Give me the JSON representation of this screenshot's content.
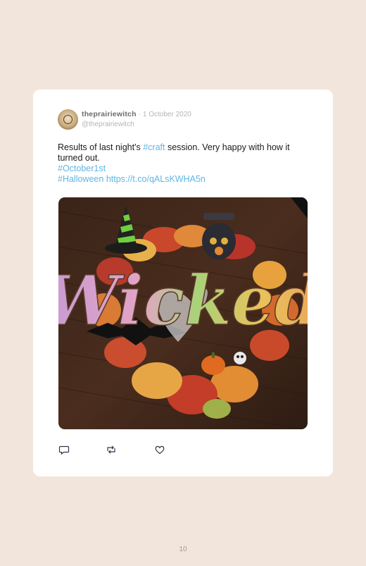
{
  "tweet": {
    "display_name": "theprairiewitch",
    "separator": "·",
    "date": "1 October 2020",
    "handle": "@theprairiewitch",
    "text_part1": "Results of last night's ",
    "hashtag_craft": "#craft",
    "text_part2": " session. Very happy with how it turned out.",
    "hashtag_october": "#October1st",
    "hashtag_halloween": "#Halloween",
    "link": "https://t.co/qALsKWHA5n",
    "photo_text": "Wicked"
  },
  "actions": {
    "reply_icon": "reply-icon",
    "retweet_icon": "retweet-icon",
    "like_icon": "heart-icon"
  },
  "page": {
    "number": "10"
  },
  "colors": {
    "background": "#f2e6dc",
    "card": "#ffffff",
    "link": "#5fb6e5"
  }
}
